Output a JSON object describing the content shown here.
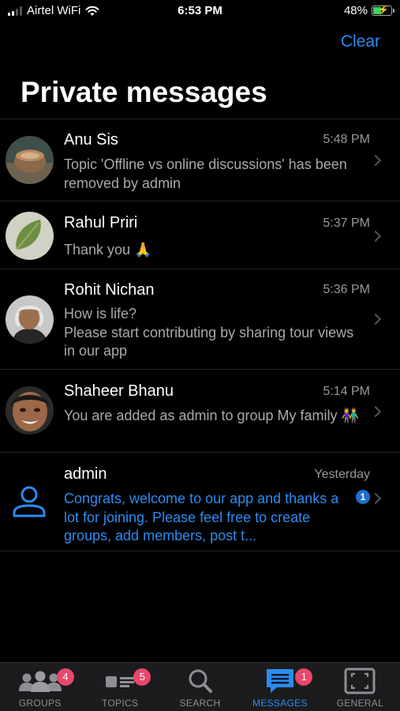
{
  "status_bar": {
    "carrier": "Airtel WiFi",
    "time": "6:53 PM",
    "battery": "48%",
    "battery_level": 0.48
  },
  "header": {
    "clear_label": "Clear",
    "title": "Private messages"
  },
  "messages": [
    {
      "name": "Anu Sis",
      "time": "5:48 PM",
      "text": "Topic 'Offline vs online discussions' has been removed by admin"
    },
    {
      "name": "Rahul Priri",
      "time": "5:37 PM",
      "text": "Thank you",
      "emoji": "🙏"
    },
    {
      "name": "Rohit Nichan",
      "time": "5:36 PM",
      "text_line1": "How is life?",
      "text_line2": "Please start contributing by sharing tour views in our app"
    },
    {
      "name": "Shaheer Bhanu",
      "time": "5:14 PM",
      "text": "You are added as admin to group My family",
      "emoji": "👫"
    },
    {
      "name": "admin",
      "time": "Yesterday",
      "text": "Congrats, welcome to our app and thanks a lot for joining. Please feel free to create groups, add members, post t...",
      "unread": "1",
      "highlight_color": "#2b8cf0"
    }
  ],
  "tabbar": {
    "tabs": [
      {
        "label": "GROUPS",
        "badge": "4",
        "icon": "groups-icon"
      },
      {
        "label": "TOPICS",
        "badge": "5",
        "icon": "topics-icon"
      },
      {
        "label": "SEARCH",
        "icon": "search-icon"
      },
      {
        "label": "MESSAGES",
        "badge": "1",
        "icon": "messages-icon",
        "active": true
      },
      {
        "label": "GENERAL",
        "icon": "general-icon"
      }
    ],
    "active_color": "#2b8cf0",
    "badge_color": "#e8476a"
  }
}
